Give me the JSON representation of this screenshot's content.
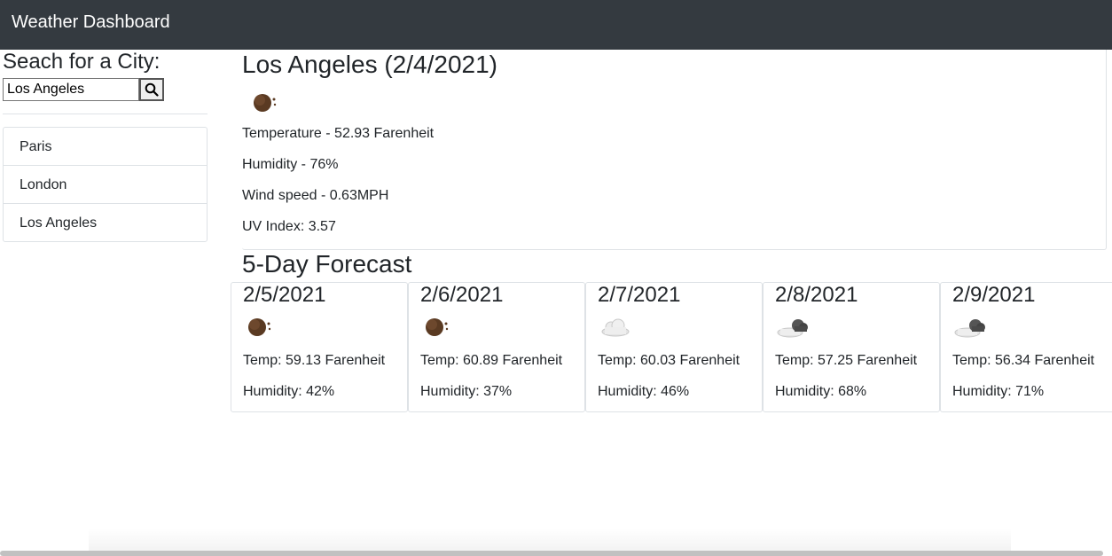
{
  "navbar": {
    "brand": "Weather Dashboard"
  },
  "search": {
    "heading": "Seach for a City:",
    "value": "Los Angeles",
    "button_icon": "search-icon"
  },
  "history": {
    "items": [
      {
        "label": "Paris"
      },
      {
        "label": "London"
      },
      {
        "label": "Los Angeles"
      }
    ]
  },
  "current": {
    "title": "Los Angeles (2/4/2021)",
    "icon": "clear-night-icon",
    "temperature": "Temperature - 52.93 Farenheit",
    "humidity": "Humidity - 76%",
    "wind": "Wind speed - 0.63MPH",
    "uv": "UV Index: 3.57"
  },
  "forecast": {
    "title": "5-Day Forecast",
    "days": [
      {
        "date": "2/5/2021",
        "icon": "clear-night-icon",
        "temp": "Temp: 59.13 Farenheit",
        "humidity": "Humidity: 42%"
      },
      {
        "date": "2/6/2021",
        "icon": "clear-night-icon",
        "temp": "Temp: 60.89 Farenheit",
        "humidity": "Humidity: 37%"
      },
      {
        "date": "2/7/2021",
        "icon": "cloud-icon",
        "temp": "Temp: 60.03 Farenheit",
        "humidity": "Humidity: 46%"
      },
      {
        "date": "2/8/2021",
        "icon": "broken-clouds-icon",
        "temp": "Temp: 57.25 Farenheit",
        "humidity": "Humidity: 68%"
      },
      {
        "date": "2/9/2021",
        "icon": "broken-clouds-icon",
        "temp": "Temp: 56.34 Farenheit",
        "humidity": "Humidity: 71%"
      }
    ]
  }
}
